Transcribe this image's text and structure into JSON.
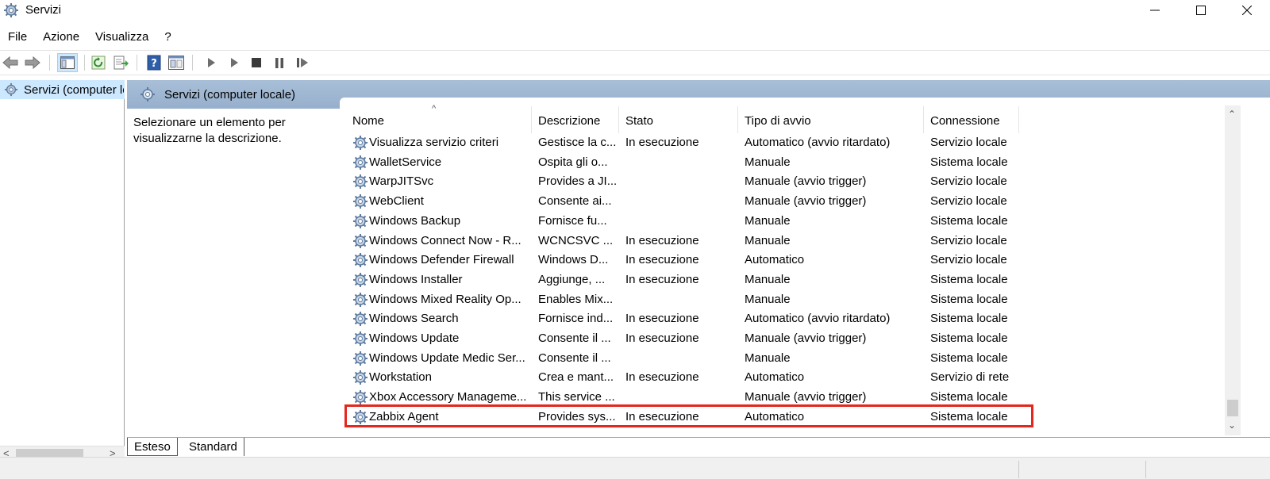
{
  "window": {
    "title": "Servizi"
  },
  "menu": [
    "File",
    "Azione",
    "Visualizza",
    "?"
  ],
  "toolbar": {
    "icons": [
      "back-arrow-icon",
      "forward-arrow-icon",
      "show-hide-console-tree-icon",
      "refresh-icon",
      "export-list-icon",
      "help-icon",
      "properties-icon",
      "start-service-icon",
      "start-alt-icon",
      "stop-service-icon",
      "pause-service-icon",
      "resume-service-icon"
    ]
  },
  "tree": {
    "item": "Servizi (computer locale)"
  },
  "panel": {
    "header": "Servizi (computer locale)",
    "description": "Selezionare un elemento per visualizzarne la descrizione."
  },
  "columns": [
    "Nome",
    "Descrizione",
    "Stato",
    "Tipo di avvio",
    "Connessione"
  ],
  "rows": [
    {
      "name": "Visualizza servizio criteri",
      "desc": "Gestisce la c...",
      "state": "In esecuzione",
      "startup": "Automatico (avvio ritardato)",
      "logon": "Servizio locale"
    },
    {
      "name": "WalletService",
      "desc": "Ospita gli o...",
      "state": "",
      "startup": "Manuale",
      "logon": "Sistema locale"
    },
    {
      "name": "WarpJITSvc",
      "desc": "Provides a JI...",
      "state": "",
      "startup": "Manuale (avvio trigger)",
      "logon": "Servizio locale"
    },
    {
      "name": "WebClient",
      "desc": "Consente ai...",
      "state": "",
      "startup": "Manuale (avvio trigger)",
      "logon": "Servizio locale"
    },
    {
      "name": "Windows Backup",
      "desc": "Fornisce fu...",
      "state": "",
      "startup": "Manuale",
      "logon": "Sistema locale"
    },
    {
      "name": "Windows Connect Now - R...",
      "desc": "WCNCSVC ...",
      "state": "In esecuzione",
      "startup": "Manuale",
      "logon": "Servizio locale"
    },
    {
      "name": "Windows Defender Firewall",
      "desc": "Windows D...",
      "state": "In esecuzione",
      "startup": "Automatico",
      "logon": "Servizio locale"
    },
    {
      "name": "Windows Installer",
      "desc": "Aggiunge, ...",
      "state": "In esecuzione",
      "startup": "Manuale",
      "logon": "Sistema locale"
    },
    {
      "name": "Windows Mixed Reality Op...",
      "desc": "Enables Mix...",
      "state": "",
      "startup": "Manuale",
      "logon": "Sistema locale"
    },
    {
      "name": "Windows Search",
      "desc": "Fornisce ind...",
      "state": "In esecuzione",
      "startup": "Automatico (avvio ritardato)",
      "logon": "Sistema locale"
    },
    {
      "name": "Windows Update",
      "desc": "Consente il ...",
      "state": "In esecuzione",
      "startup": "Manuale (avvio trigger)",
      "logon": "Sistema locale"
    },
    {
      "name": "Windows Update Medic Ser...",
      "desc": "Consente il ...",
      "state": "",
      "startup": "Manuale",
      "logon": "Sistema locale"
    },
    {
      "name": "Workstation",
      "desc": "Crea e mant...",
      "state": "In esecuzione",
      "startup": "Automatico",
      "logon": "Servizio di rete"
    },
    {
      "name": "Xbox Accessory Manageme...",
      "desc": "This service ...",
      "state": "",
      "startup": "Manuale (avvio trigger)",
      "logon": "Sistema locale"
    },
    {
      "name": "Zabbix Agent",
      "desc": "Provides sys...",
      "state": "In esecuzione",
      "startup": "Automatico",
      "logon": "Sistema locale"
    }
  ],
  "tabs": [
    "Esteso",
    "Standard"
  ],
  "colors": {
    "highlight": "#e5261c",
    "header_band": "#a9bfd8",
    "tree_selected": "#cce8ff"
  }
}
